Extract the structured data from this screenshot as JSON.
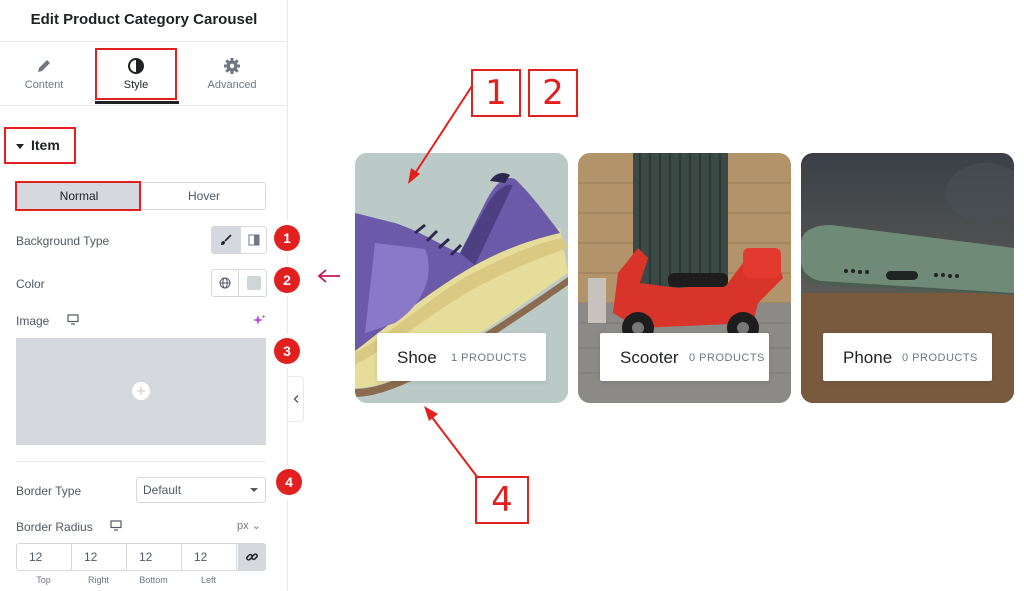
{
  "panel": {
    "title": "Edit Product Category Carousel",
    "tabs": [
      {
        "label": "Content",
        "icon": "pencil-icon"
      },
      {
        "label": "Style",
        "icon": "half-circle-icon"
      },
      {
        "label": "Advanced",
        "icon": "gear-icon"
      }
    ],
    "active_tab": "Style"
  },
  "section": {
    "title": "Item"
  },
  "state_tabs": {
    "normal": "Normal",
    "hover": "Hover",
    "active": "Normal"
  },
  "controls": {
    "background_type": {
      "label": "Background Type",
      "options": [
        "classic-icon",
        "gradient-icon"
      ],
      "selected": "classic"
    },
    "color": {
      "label": "Color",
      "swatch": "#d0d5d8"
    },
    "image": {
      "label": "Image"
    },
    "border_type": {
      "label": "Border Type",
      "value": "Default"
    },
    "border_radius": {
      "label": "Border Radius",
      "unit": "px",
      "values": [
        {
          "label": "Top",
          "value": "12"
        },
        {
          "label": "Right",
          "value": "12"
        },
        {
          "label": "Bottom",
          "value": "12"
        },
        {
          "label": "Left",
          "value": "12"
        }
      ]
    }
  },
  "annotations": {
    "markers": [
      "1",
      "2",
      "3",
      "4"
    ],
    "boxes": [
      "1",
      "2",
      "4"
    ],
    "accent": "#e2201f"
  },
  "carousel": {
    "items": [
      {
        "name": "Shoe",
        "count": "1 PRODUCTS"
      },
      {
        "name": "Scooter",
        "count": "0 PRODUCTS"
      },
      {
        "name": "Phone",
        "count": "0 PRODUCTS"
      }
    ]
  }
}
